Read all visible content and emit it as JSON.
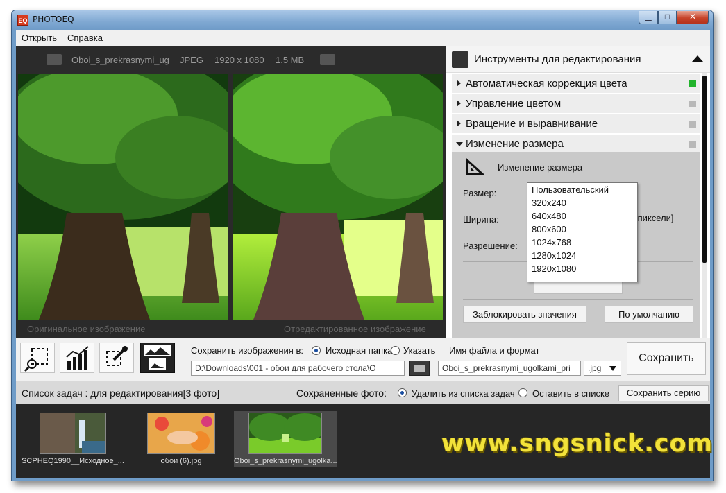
{
  "window": {
    "title": "PHOTOEQ",
    "logo_text": "EQ",
    "min_glyph": "▁",
    "max_glyph": "□",
    "close_glyph": "✕"
  },
  "menu": {
    "items": [
      "Открыть",
      "Справка"
    ]
  },
  "image_info": {
    "filename": "Oboi_s_prekrasnymi_ug",
    "format": "JPEG",
    "dimensions": "1920 x 1080",
    "size": "1.5 MB"
  },
  "viewer": {
    "original_caption": "Оригинальное изображение",
    "edited_caption": "Отредактированное изображение"
  },
  "tools": {
    "title": "Инструменты для редактирования",
    "sections": [
      {
        "label": "Автоматическая коррекция цвета",
        "active": true
      },
      {
        "label": "Управление цветом",
        "active": false
      },
      {
        "label": "Вращение и выравнивание",
        "active": false
      },
      {
        "label": "Изменение размера",
        "active": false
      }
    ],
    "resize": {
      "subtitle": "Изменение размера",
      "size_label": "Размер:",
      "width_label": "Ширина:",
      "units_label": "[пиксели]",
      "resolution_label": "Разрешение:",
      "options": [
        "Пользовательский",
        "320x240",
        "640x480",
        "800x600",
        "1024x768",
        "1280x1024",
        "1920x1080"
      ],
      "lock_button": "Заблокировать значения",
      "default_button": "По умолчанию"
    }
  },
  "save": {
    "save_to_label": "Сохранить изображения в:",
    "option_source": "Исходная папка",
    "option_specify": "Указать",
    "filename_label": "Имя файла и формат",
    "path_value": "D:\\Downloads\\001 - обои для рабочего стола\\О",
    "name_value": "Oboi_s_prekrasnymi_ugolkami_pri",
    "format_value": ".jpg",
    "save_button": "Сохранить"
  },
  "queue": {
    "title": "Список задач : для редактирования[3 фото]",
    "saved_label": "Сохраненные фото:",
    "option_remove": "Удалить из списка задач",
    "option_keep": "Оставить в списке",
    "batch_button": "Сохранить серию",
    "items": [
      {
        "name": "SCPHEQ1990__Исходное_..."
      },
      {
        "name": "обои (6).jpg"
      },
      {
        "name": "Oboi_s_prekrasnymi_ugolka..."
      }
    ]
  },
  "watermark": "www.sngsnick.com",
  "colors": {
    "accent_green": "#22b32c",
    "watermark_yellow": "#f2e23a",
    "dark_bg": "#2a2a2a"
  }
}
